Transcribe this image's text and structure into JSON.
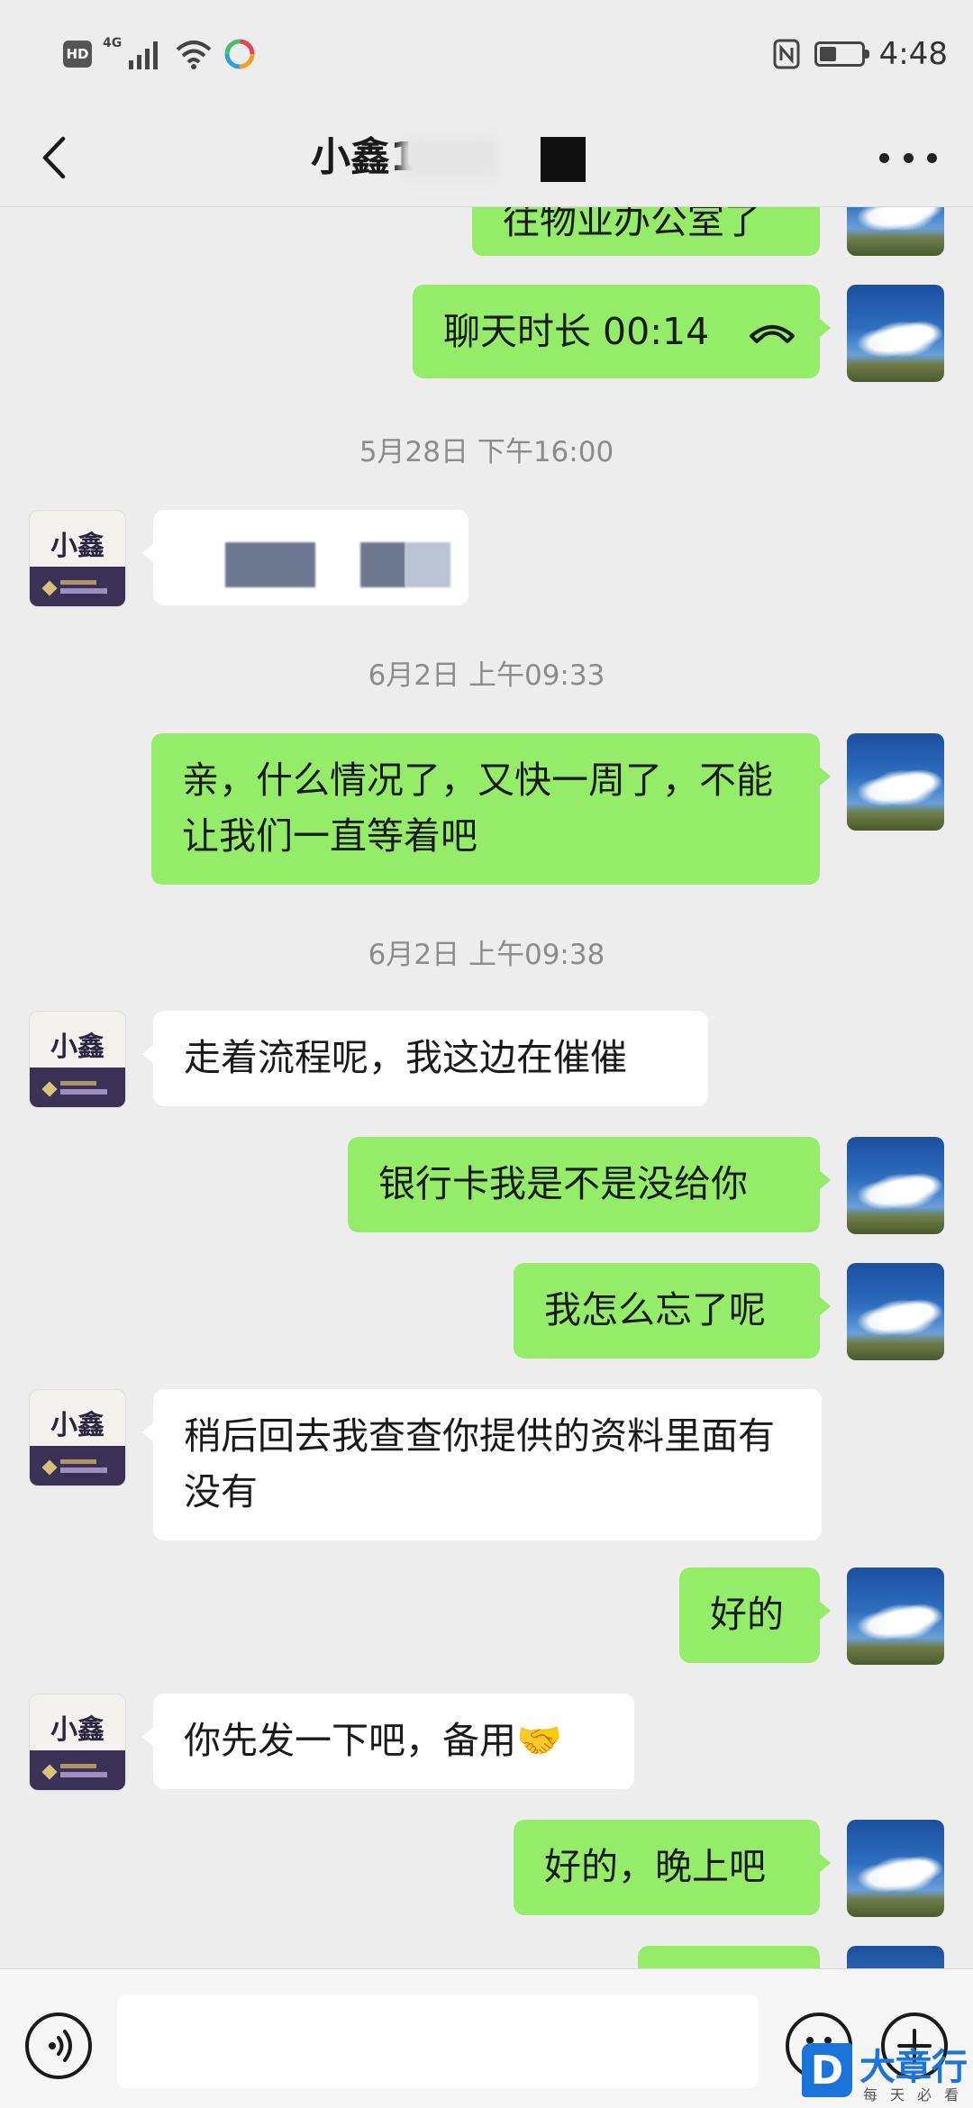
{
  "status_bar": {
    "hd": "HD",
    "network": "4G",
    "time": "4:48"
  },
  "header": {
    "title": "小鑫1"
  },
  "messages": [
    {
      "side": "me",
      "text": "往物业办公室了"
    },
    {
      "side": "me",
      "text": "聊天时长 00:14"
    },
    {
      "timestamp": "5月28日 下午16:00"
    },
    {
      "side": "them",
      "text": ""
    },
    {
      "timestamp": "6月2日 上午09:33"
    },
    {
      "side": "me",
      "text": "亲，什么情况了，又快一周了，不能让我们一直等着吧"
    },
    {
      "timestamp": "6月2日 上午09:38"
    },
    {
      "side": "them",
      "text": "走着流程呢，我这边在催催"
    },
    {
      "side": "me",
      "text": "银行卡我是不是没给你"
    },
    {
      "side": "me",
      "text": "我怎么忘了呢"
    },
    {
      "side": "them",
      "text": "稍后回去我查查你提供的资料里面有没有"
    },
    {
      "side": "me",
      "text": "好的"
    },
    {
      "side": "them",
      "text": "你先发一下吧，备用🤝"
    },
    {
      "side": "me",
      "text": "好的，晚上吧"
    }
  ],
  "contact_avatar": {
    "text": "小鑫"
  },
  "input": {
    "placeholder": ""
  },
  "watermark": {
    "logo": "D",
    "title": "大章行",
    "subtitle": "每天必看"
  },
  "icons": {
    "back": "back-arrow-icon",
    "more": "more-dots-icon",
    "call": "hangup-icon",
    "voice": "voice-icon",
    "emoji": "emoji-icon",
    "plus": "plus-icon"
  },
  "colors": {
    "bg": "#ededed",
    "me_bubble": "#95ec69",
    "them_bubble": "#ffffff"
  }
}
